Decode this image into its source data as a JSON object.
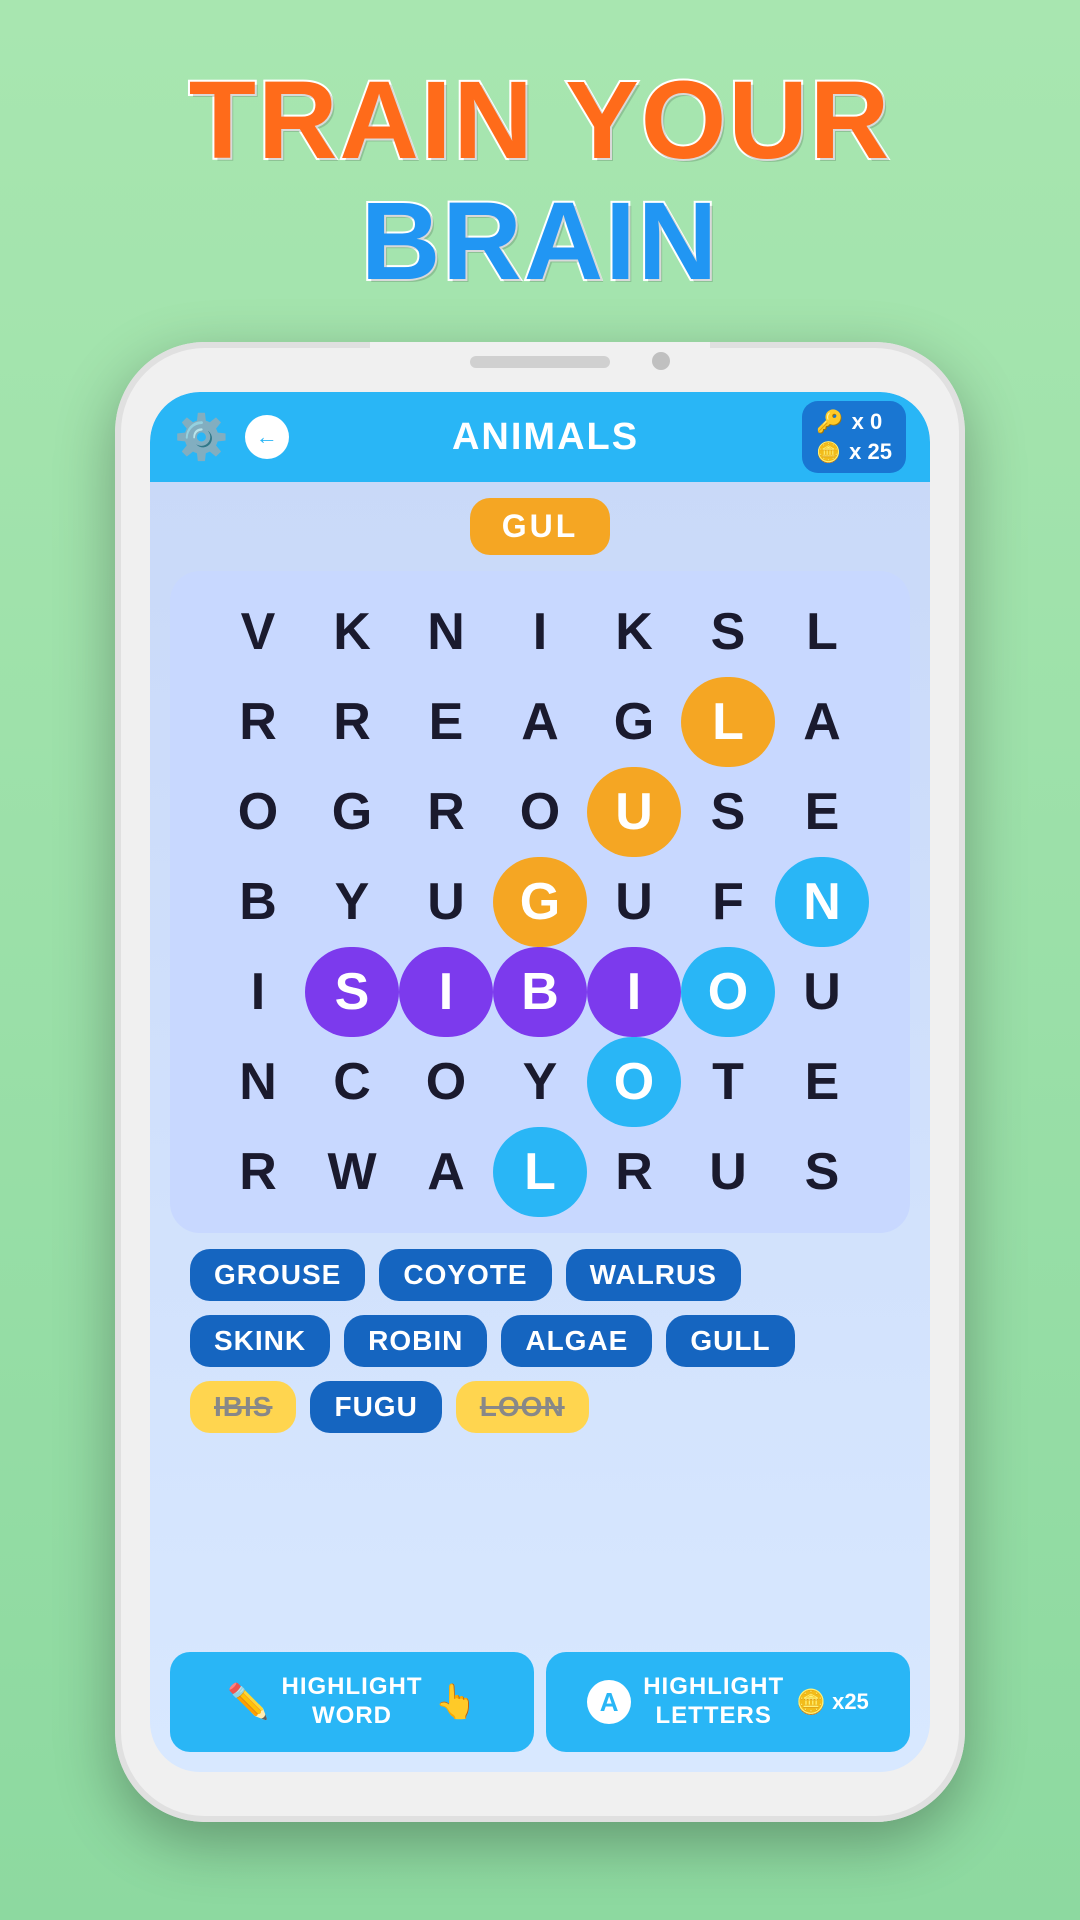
{
  "title": {
    "line1": "TRAIN YOUR",
    "line2": "BRAIN"
  },
  "header": {
    "category": "ANIMALS",
    "keys_label": "x 0",
    "coins_label": "x 25"
  },
  "current_word": "GUL",
  "grid": {
    "rows": [
      [
        "V",
        "K",
        "N",
        "I",
        "K",
        "S",
        "L"
      ],
      [
        "R",
        "R",
        "E",
        "A",
        "G",
        "L",
        "A"
      ],
      [
        "O",
        "G",
        "R",
        "O",
        "U",
        "S",
        "E"
      ],
      [
        "B",
        "Y",
        "U",
        "G",
        "U",
        "F",
        "N"
      ],
      [
        "I",
        "S",
        "I",
        "B",
        "I",
        "O",
        "U"
      ],
      [
        "N",
        "C",
        "O",
        "Y",
        "O",
        "T",
        "E"
      ],
      [
        "R",
        "W",
        "A",
        "L",
        "R",
        "U",
        "S"
      ]
    ],
    "orange_highlight": [
      [
        1,
        4
      ],
      [
        2,
        4
      ],
      [
        3,
        3
      ]
    ],
    "blue_highlight": [
      [
        2,
        4
      ],
      [
        3,
        6
      ],
      [
        4,
        5
      ],
      [
        5,
        4
      ],
      [
        6,
        3
      ]
    ],
    "purple_highlight": [
      [
        4,
        1
      ],
      [
        4,
        2
      ],
      [
        4,
        3
      ],
      [
        4,
        4
      ]
    ]
  },
  "words": [
    {
      "text": "GROUSE",
      "struck": false
    },
    {
      "text": "COYOTE",
      "struck": false
    },
    {
      "text": "WALRUS",
      "struck": false
    },
    {
      "text": "SKINK",
      "struck": false
    },
    {
      "text": "ROBIN",
      "struck": false
    },
    {
      "text": "ALGAE",
      "struck": false
    },
    {
      "text": "GULL",
      "struck": false
    },
    {
      "text": "IBIS",
      "struck": true
    },
    {
      "text": "FUGU",
      "struck": false
    },
    {
      "text": "LOON",
      "struck": true
    }
  ],
  "buttons": {
    "highlight_word_label": "HIGHLIGHT\nWORD",
    "highlight_letters_label": "HIGHLIGHT\nLETTERS",
    "highlight_letters_cost": "x25"
  }
}
